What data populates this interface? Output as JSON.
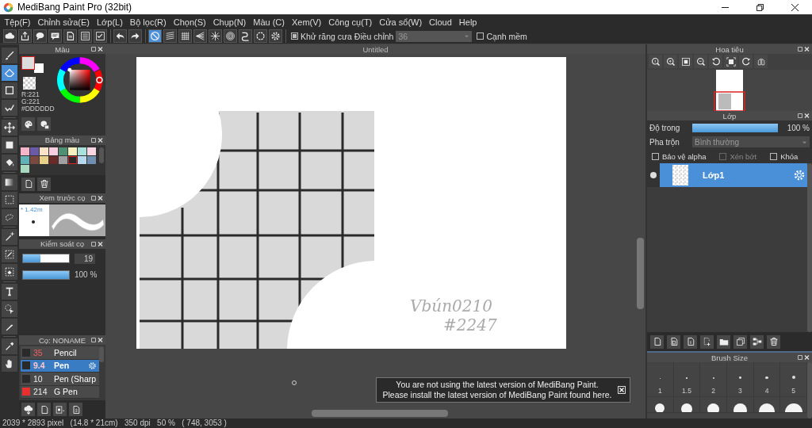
{
  "window": {
    "title": "MediBang Paint Pro (32bit)"
  },
  "menu": [
    "Tệp(F)",
    "Chỉnh sửa(E)",
    "Lớp(L)",
    "Bộ lọc(R)",
    "Chọn(S)",
    "Chụp(N)",
    "Màu (C)",
    "Xem(V)",
    "Công cụ(T)",
    "Cửa sổ(W)",
    "Cloud",
    "Help"
  ],
  "toolbar": {
    "groups": [
      [
        {
          "kind": "cloud",
          "selected": false
        },
        {
          "kind": "share",
          "selected": false
        },
        {
          "kind": "chat",
          "selected": false
        },
        {
          "kind": "comment",
          "selected": false
        },
        {
          "kind": "page",
          "selected": false
        },
        {
          "kind": "list",
          "selected": false
        },
        {
          "kind": "checklist",
          "selected": false
        }
      ],
      [
        {
          "kind": "undo",
          "selected": false
        },
        {
          "kind": "redo",
          "selected": false
        }
      ],
      [
        {
          "kind": "snap-off",
          "selected": true
        },
        {
          "kind": "parallel",
          "selected": false
        },
        {
          "kind": "grid",
          "selected": false
        },
        {
          "kind": "perspective",
          "selected": false
        },
        {
          "kind": "radial",
          "selected": false
        },
        {
          "kind": "concentric",
          "selected": false
        },
        {
          "kind": "curve",
          "selected": false
        },
        {
          "kind": "circle",
          "selected": false
        },
        {
          "kind": "gear",
          "selected": false
        }
      ]
    ],
    "antialias": {
      "label": "Khử răng cưa",
      "checked": true
    },
    "correction": {
      "label": "Điều chỉnh",
      "value": "36"
    },
    "soft_edge": {
      "label": "Cạnh mềm",
      "checked": false
    }
  },
  "tools": [
    {
      "kind": "brush",
      "selected": false
    },
    {
      "kind": "eraser",
      "selected": true
    },
    {
      "kind": "square",
      "selected": false
    },
    {
      "kind": "polyline",
      "selected": false
    },
    {
      "kind": "move",
      "selected": false
    },
    {
      "kind": "filled-square",
      "selected": false
    },
    {
      "kind": "bucket",
      "selected": false
    },
    {
      "kind": "gradient",
      "selected": false
    },
    {
      "kind": "select-rect",
      "selected": false
    },
    {
      "kind": "lasso",
      "selected": false
    },
    {
      "kind": "wand",
      "selected": false
    },
    {
      "kind": "select-pen",
      "selected": false
    },
    {
      "kind": "select-eraser",
      "selected": false
    },
    {
      "kind": "text",
      "selected": false
    },
    {
      "kind": "pointer",
      "selected": false
    },
    {
      "kind": "knife",
      "selected": false
    },
    {
      "kind": "eyedropper",
      "selected": false
    },
    {
      "kind": "hand",
      "selected": false
    }
  ],
  "color_panel": {
    "title": "Màu",
    "primary": {
      "color": "#dddddd"
    },
    "readings": [
      "R:221",
      "G:221",
      "#DDDDDD"
    ]
  },
  "palette_panel": {
    "title": "Bảng màu",
    "swatches": [
      {
        "color": "#f4b6c8",
        "selected": false
      },
      {
        "color": "#6a5aa8",
        "selected": false
      },
      {
        "color": "#fbe3c8",
        "selected": false
      },
      {
        "color": "#f8cfe0",
        "selected": false
      },
      {
        "color": "#4f8f72",
        "selected": false
      },
      {
        "color": "#f7f0c0",
        "selected": false
      },
      {
        "color": "#a8e0dc",
        "selected": false
      },
      {
        "color": "#f9d6e4",
        "selected": false
      },
      {
        "color": "#5fb3b8",
        "selected": false
      },
      {
        "color": "#7a4a40",
        "selected": false
      },
      {
        "color": "#e8d28a",
        "selected": false
      },
      {
        "color": "#6b2a2a",
        "selected": false
      },
      {
        "color": "#a0a0a0",
        "selected": false
      },
      {
        "color": "#2a2a2a",
        "selected": true
      },
      {
        "color": "#b8d8f0",
        "selected": false
      },
      {
        "color": "#6f8fb0",
        "selected": false
      },
      {
        "color": "#a8d8c0",
        "selected": false
      }
    ]
  },
  "preview_panel": {
    "title": "Xem trước cọ",
    "size": "* 1.42m"
  },
  "brush_control": {
    "title": "Kiểm soát cọ",
    "sliders": [
      {
        "level": 0.38,
        "reading": "19",
        "boxed": true
      },
      {
        "level": 1,
        "reading": "100 %",
        "boxed": false
      }
    ]
  },
  "brush_panel": {
    "title": "Cọ: NONAME",
    "brushes": [
      {
        "size": "35",
        "name": "Pencil",
        "color": "#2a2a2a",
        "accent": true,
        "selected": false
      },
      {
        "size": "9.4",
        "name": "Pen",
        "color": "#2a2a2a",
        "accent": true,
        "selected": true
      },
      {
        "size": "10",
        "name": "Pen (Sharp",
        "color": "#2a2a2a",
        "accent": false,
        "selected": false
      },
      {
        "size": "214",
        "name": "G Pen",
        "color": "#e83030",
        "accent": false,
        "selected": false
      }
    ]
  },
  "canvas": {
    "title": "Untitled",
    "signature": [
      "Vbún0210",
      "#2247"
    ],
    "notice": [
      "You are not using the latest version of MediBang Paint.",
      "Please install the latest version of MediBang Paint found here."
    ]
  },
  "navigator": {
    "title": "Hoa tiêu",
    "tools": [
      {
        "kind": "zoom-reset"
      },
      {
        "kind": "zoom-in"
      },
      {
        "kind": "fit"
      },
      {
        "kind": "zoom-out"
      },
      {
        "kind": "rotate-left"
      },
      {
        "kind": "fullscreen"
      },
      {
        "kind": "rotate-right"
      },
      {
        "kind": "flip"
      }
    ]
  },
  "layer_panel": {
    "title": "Lớp",
    "opacity": {
      "label": "Độ trong",
      "level": 1,
      "reading": "100 %"
    },
    "blend": {
      "label": "Pha trộn",
      "value": "Bình thường"
    },
    "checkboxes": [
      {
        "label": "Bảo vệ alpha",
        "checked": false,
        "disabled": false
      },
      {
        "label": "Xén bớt",
        "checked": false,
        "disabled": true
      },
      {
        "label": "Khóa",
        "checked": false,
        "disabled": false
      }
    ],
    "layers": [
      {
        "name": "Lớp1",
        "visible": true,
        "selected": true
      }
    ],
    "tools": [
      {
        "kind": "new-page"
      },
      {
        "kind": "new-page-8"
      },
      {
        "kind": "new-page-1"
      },
      {
        "kind": "add-menu"
      },
      {
        "kind": "folder"
      },
      {
        "kind": "copy"
      },
      {
        "kind": "merge"
      },
      {
        "kind": "delete"
      }
    ]
  },
  "brush_size": {
    "title": "Brush Size",
    "sizes": [
      "1",
      "1.5",
      "2",
      "3",
      "4",
      "5"
    ]
  },
  "status_bar": "2039 * 2893 pixel   (14.8 * 21cm)   350 dpi   50 %   ( 748, 3053 )"
}
